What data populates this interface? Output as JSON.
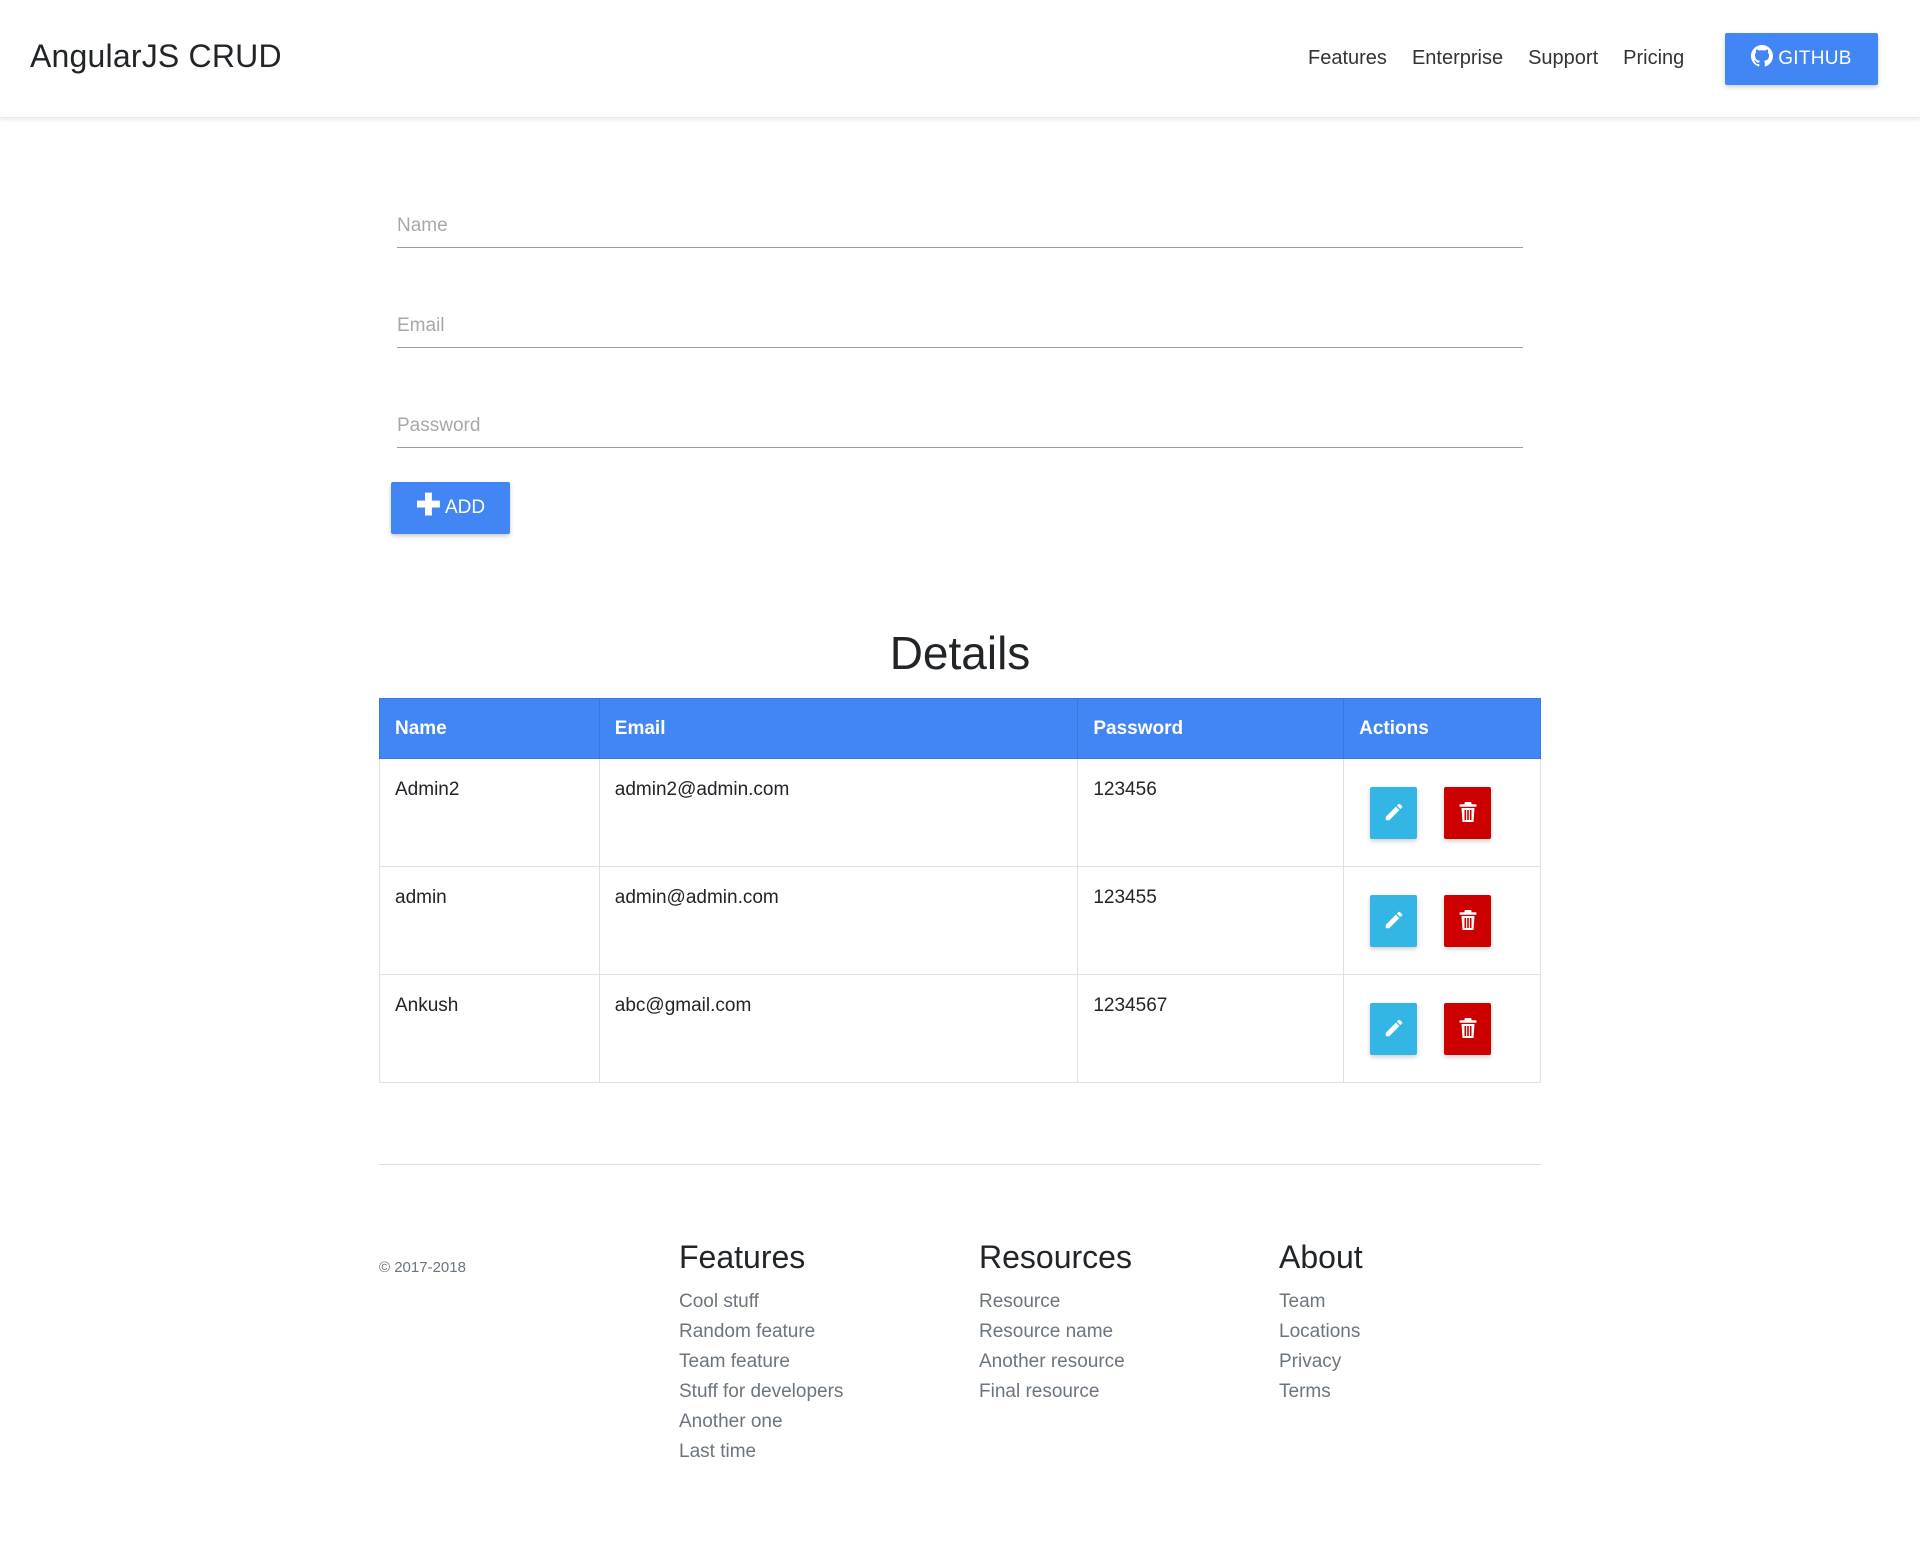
{
  "header": {
    "brand": "AngularJS CRUD",
    "nav": [
      "Features",
      "Enterprise",
      "Support",
      "Pricing"
    ],
    "github_label": "GITHUB"
  },
  "form": {
    "name_placeholder": "Name",
    "email_placeholder": "Email",
    "password_placeholder": "Password",
    "add_label": "ADD"
  },
  "details": {
    "title": "Details",
    "columns": [
      "Name",
      "Email",
      "Password",
      "Actions"
    ],
    "rows": [
      {
        "name": "Admin2",
        "email": "admin2@admin.com",
        "password": "123456"
      },
      {
        "name": "admin",
        "email": "admin@admin.com",
        "password": "123455"
      },
      {
        "name": "Ankush",
        "email": "abc@gmail.com",
        "password": "1234567"
      }
    ]
  },
  "footer": {
    "copyright": "© 2017-2018",
    "columns": [
      {
        "title": "Features",
        "links": [
          "Cool stuff",
          "Random feature",
          "Team feature",
          "Stuff for developers",
          "Another one",
          "Last time"
        ]
      },
      {
        "title": "Resources",
        "links": [
          "Resource",
          "Resource name",
          "Another resource",
          "Final resource"
        ]
      },
      {
        "title": "About",
        "links": [
          "Team",
          "Locations",
          "Privacy",
          "Terms"
        ]
      }
    ]
  },
  "colors": {
    "primary": "#4285f4",
    "edit": "#33b5e5",
    "delete": "#cc0000"
  },
  "icons": {
    "github": "github-icon",
    "add": "plus-icon",
    "edit": "pencil-icon",
    "delete": "trash-icon"
  }
}
